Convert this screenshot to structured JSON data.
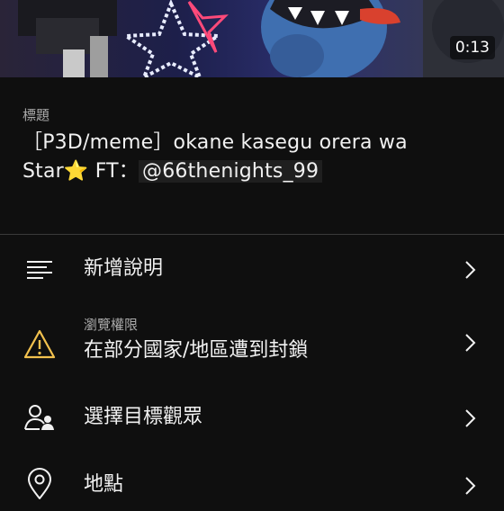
{
  "video": {
    "duration": "0:13"
  },
  "title_section": {
    "label": "標題",
    "line1": "［P3D/meme］okane kasegu orera wa",
    "line2_prefix": "Star⭐ FT：",
    "mention": "@66thenights_99"
  },
  "settings": [
    {
      "label": "新增說明",
      "icon": "description-lines-icon"
    },
    {
      "sublabel": "瀏覽權限",
      "label": "在部分國家/地區遭到封鎖",
      "icon": "warning-icon"
    },
    {
      "label": "選擇目標觀眾",
      "icon": "audience-icon"
    },
    {
      "label": "地點",
      "icon": "location-pin-icon"
    }
  ],
  "colors": {
    "background": "#0f0f0f",
    "warning": "#f2c14e",
    "text": "#f1f1f1",
    "secondary_text": "#aaaaaa"
  }
}
